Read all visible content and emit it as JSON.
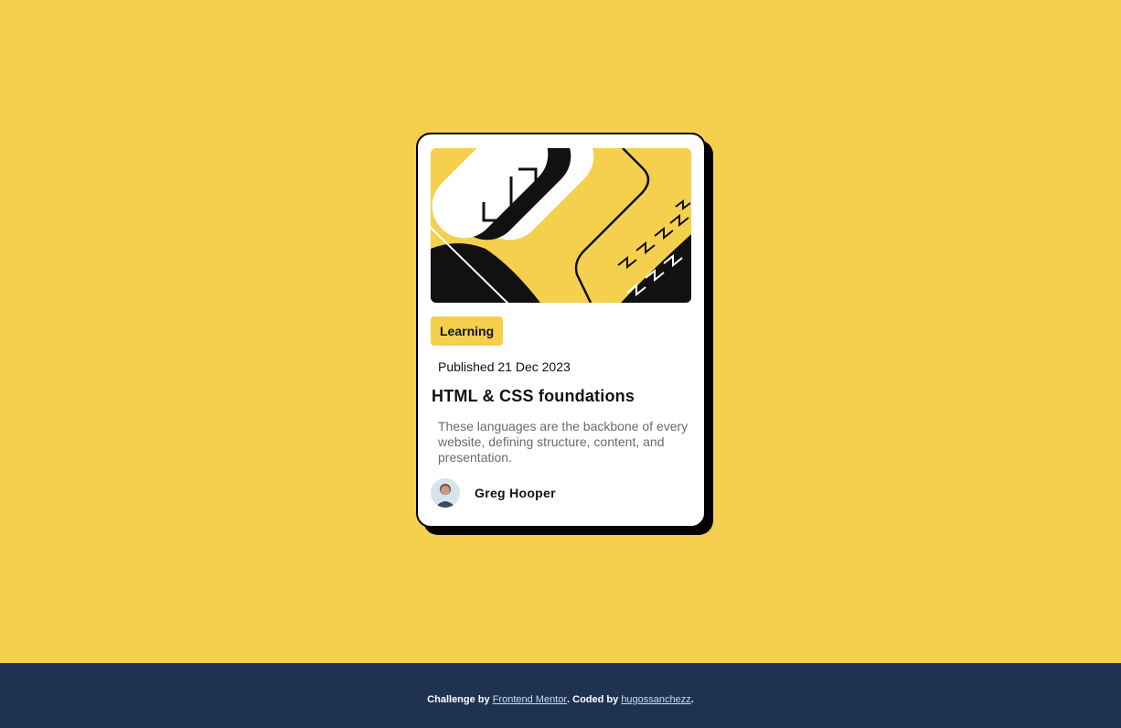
{
  "colors": {
    "background": "#f4d04e",
    "card": "#ffffff",
    "border": "#000000",
    "footer": "#1f3251"
  },
  "card": {
    "image_icon": "abstract-illustration",
    "tag": "Learning",
    "published": "Published 21 Dec 2023",
    "title": "HTML & CSS foundations",
    "description": "These languages are the backbone of every website, defining structure, content, and presentation.",
    "author": {
      "name": "Greg Hooper",
      "avatar_icon": "avatar-photo"
    }
  },
  "footer": {
    "prefix": "Challenge by ",
    "link1": "Frontend Mentor",
    "middle": ". Coded by ",
    "link2": "hugossanchezz",
    "suffix": "."
  }
}
